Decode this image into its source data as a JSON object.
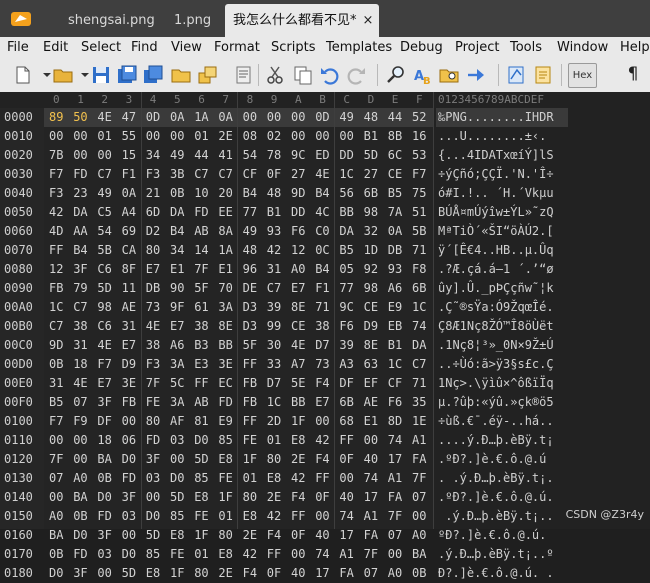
{
  "tabs": [
    {
      "label": "shengsai.png",
      "active": false
    },
    {
      "label": "1.png",
      "active": false
    },
    {
      "label": "我怎么什么都看不见*",
      "active": true
    }
  ],
  "tab_close_glyph": "×",
  "menu": [
    "File",
    "Edit",
    "Select",
    "Find",
    "View",
    "Format",
    "Scripts",
    "Templates",
    "Debug",
    "Project",
    "Tools",
    "Window",
    "Help"
  ],
  "toolbar": {
    "hex_label": "Hex",
    "pilcrow": "¶"
  },
  "ruler": {
    "hex": [
      "0",
      "1",
      "2",
      "3",
      "4",
      "5",
      "6",
      "7",
      "8",
      "9",
      "A",
      "B",
      "C",
      "D",
      "E",
      "F"
    ],
    "ascii": "0123456789ABCDEF"
  },
  "rows": [
    {
      "addr": "0000",
      "bytes": [
        "89",
        "50",
        "4E",
        "47",
        "0D",
        "0A",
        "1A",
        "0A",
        "00",
        "00",
        "00",
        "0D",
        "49",
        "48",
        "44",
        "52"
      ],
      "ascii": "‰PNG........IHDR"
    },
    {
      "addr": "0010",
      "bytes": [
        "00",
        "00",
        "01",
        "55",
        "00",
        "00",
        "01",
        "2E",
        "08",
        "02",
        "00",
        "00",
        "00",
        "B1",
        "8B",
        "16"
      ],
      "ascii": "...U........±‹."
    },
    {
      "addr": "0020",
      "bytes": [
        "7B",
        "00",
        "00",
        "15",
        "34",
        "49",
        "44",
        "41",
        "54",
        "78",
        "9C",
        "ED",
        "DD",
        "5D",
        "6C",
        "53"
      ],
      "ascii": "{...4IDATxœíÝ]lS"
    },
    {
      "addr": "0030",
      "bytes": [
        "F7",
        "FD",
        "C7",
        "F1",
        "F3",
        "3B",
        "C7",
        "C7",
        "CF",
        "0F",
        "27",
        "4E",
        "1C",
        "27",
        "CE",
        "F7"
      ],
      "ascii": "÷ýÇñó;ÇÇÏ.'N.'Î÷"
    },
    {
      "addr": "0040",
      "bytes": [
        "F3",
        "23",
        "49",
        "0A",
        "21",
        "0B",
        "10",
        "20",
        "B4",
        "48",
        "9D",
        "B4",
        "56",
        "6B",
        "B5",
        "75"
      ],
      "ascii": "ó#I.!.. ´H.´Vkµu"
    },
    {
      "addr": "0050",
      "bytes": [
        "42",
        "DA",
        "C5",
        "A4",
        "6D",
        "DA",
        "FD",
        "EE",
        "77",
        "B1",
        "DD",
        "4C",
        "BB",
        "98",
        "7A",
        "51"
      ],
      "ascii": "BÚÅ¤mÚýîw±ÝL»˜zQ"
    },
    {
      "addr": "0060",
      "bytes": [
        "4D",
        "AA",
        "54",
        "69",
        "D2",
        "B4",
        "AB",
        "8A",
        "49",
        "93",
        "F6",
        "C0",
        "DA",
        "32",
        "0A",
        "5B"
      ],
      "ascii": "MªTiÒ´«ŠI“öÀÚ2.["
    },
    {
      "addr": "0070",
      "bytes": [
        "FF",
        "B4",
        "5B",
        "CA",
        "80",
        "34",
        "14",
        "1A",
        "48",
        "42",
        "12",
        "0C",
        "B5",
        "1D",
        "DB",
        "71"
      ],
      "ascii": "ÿ´[Ê€4..HB..µ.Ûq"
    },
    {
      "addr": "0080",
      "bytes": [
        "12",
        "3F",
        "C6",
        "8F",
        "E7",
        "E1",
        "7F",
        "E1",
        "96",
        "31",
        "A0",
        "B4",
        "05",
        "92",
        "93",
        "F8"
      ],
      "ascii": ".?Æ.çá.á–1 ´.’“ø"
    },
    {
      "addr": "0090",
      "bytes": [
        "FB",
        "79",
        "5D",
        "11",
        "DB",
        "90",
        "5F",
        "70",
        "DE",
        "C7",
        "E7",
        "F1",
        "77",
        "98",
        "A6",
        "6B"
      ],
      "ascii": "ûy].Û._pÞÇçñw˜¦k"
    },
    {
      "addr": "00A0",
      "bytes": [
        "1C",
        "C7",
        "98",
        "AE",
        "73",
        "9F",
        "61",
        "3A",
        "D3",
        "39",
        "8E",
        "71",
        "9C",
        "CE",
        "E9",
        "1C"
      ],
      "ascii": ".Ç˜®sŸa:Ó9ŽqœÎé."
    },
    {
      "addr": "00B0",
      "bytes": [
        "C7",
        "38",
        "C6",
        "31",
        "4E",
        "E7",
        "38",
        "8E",
        "D3",
        "99",
        "CE",
        "38",
        "F6",
        "D9",
        "EB",
        "74"
      ],
      "ascii": "Ç8Æ1Nç8ŽÓ™Î8öÙët"
    },
    {
      "addr": "00C0",
      "bytes": [
        "9D",
        "31",
        "4E",
        "E7",
        "38",
        "A6",
        "B3",
        "BB",
        "5F",
        "30",
        "4E",
        "D7",
        "39",
        "8E",
        "B1",
        "DA"
      ],
      "ascii": ".1Nç8¦³»_0N×9Ž±Ú"
    },
    {
      "addr": "00D0",
      "bytes": [
        "0B",
        "18",
        "F7",
        "D9",
        "F3",
        "3A",
        "E3",
        "3E",
        "FF",
        "33",
        "A7",
        "73",
        "A3",
        "63",
        "1C",
        "C7"
      ],
      "ascii": "..÷Ùó:ã>ÿ3§s£c.Ç"
    },
    {
      "addr": "00E0",
      "bytes": [
        "31",
        "4E",
        "E7",
        "3E",
        "7F",
        "5C",
        "FF",
        "EC",
        "FB",
        "D7",
        "5E",
        "F4",
        "DF",
        "EF",
        "CF",
        "71"
      ],
      "ascii": "1Nç>.\\ÿìû×^ôßïÏq"
    },
    {
      "addr": "00F0",
      "bytes": [
        "B5",
        "07",
        "3F",
        "FB",
        "FE",
        "3A",
        "AB",
        "FD",
        "FB",
        "1C",
        "BB",
        "E7",
        "6B",
        "AE",
        "F6",
        "35"
      ],
      "ascii": "µ.?ûþ:«ýû.»çk®ö5"
    },
    {
      "addr": "0100",
      "bytes": [
        "F7",
        "F9",
        "DF",
        "00",
        "80",
        "AF",
        "81",
        "E9",
        "FF",
        "2D",
        "1F",
        "00",
        "68",
        "E1",
        "8D",
        "1E"
      ],
      "ascii": "÷ùß.€¯.éÿ-..há.."
    },
    {
      "addr": "0110",
      "bytes": [
        "00",
        "00",
        "18",
        "06",
        "FD",
        "03",
        "D0",
        "85",
        "FE",
        "01",
        "E8",
        "42",
        "FF",
        "00",
        "74",
        "A1"
      ],
      "ascii": "....ý.Ð…þ.èBÿ.t¡"
    },
    {
      "addr": "0120",
      "bytes": [
        "7F",
        "00",
        "BA",
        "D0",
        "3F",
        "00",
        "5D",
        "E8",
        "1F",
        "80",
        "2E",
        "F4",
        "0F",
        "40",
        "17",
        "FA"
      ],
      "ascii": ".ºÐ?.]è.€.ô.@.ú"
    },
    {
      "addr": "0130",
      "bytes": [
        "07",
        "A0",
        "0B",
        "FD",
        "03",
        "D0",
        "85",
        "FE",
        "01",
        "E8",
        "42",
        "FF",
        "00",
        "74",
        "A1",
        "7F"
      ],
      "ascii": ". .ý.Ð…þ.èBÿ.t¡."
    },
    {
      "addr": "0140",
      "bytes": [
        "00",
        "BA",
        "D0",
        "3F",
        "00",
        "5D",
        "E8",
        "1F",
        "80",
        "2E",
        "F4",
        "0F",
        "40",
        "17",
        "FA",
        "07"
      ],
      "ascii": ".ºÐ?.]è.€.ô.@.ú."
    },
    {
      "addr": "0150",
      "bytes": [
        "A0",
        "0B",
        "FD",
        "03",
        "D0",
        "85",
        "FE",
        "01",
        "E8",
        "42",
        "FF",
        "00",
        "74",
        "A1",
        "7F",
        "00"
      ],
      "ascii": " .ý.Ð…þ.èBÿ.t¡.."
    },
    {
      "addr": "0160",
      "bytes": [
        "BA",
        "D0",
        "3F",
        "00",
        "5D",
        "E8",
        "1F",
        "80",
        "2E",
        "F4",
        "0F",
        "40",
        "17",
        "FA",
        "07",
        "A0"
      ],
      "ascii": "ºÐ?.]è.€.ô.@.ú. "
    },
    {
      "addr": "0170",
      "bytes": [
        "0B",
        "FD",
        "03",
        "D0",
        "85",
        "FE",
        "01",
        "E8",
        "42",
        "FF",
        "00",
        "74",
        "A1",
        "7F",
        "00",
        "BA"
      ],
      "ascii": ".ý.Ð…þ.èBÿ.t¡..º"
    },
    {
      "addr": "0180",
      "bytes": [
        "D0",
        "3F",
        "00",
        "5D",
        "E8",
        "1F",
        "80",
        "2E",
        "F4",
        "0F",
        "40",
        "17",
        "FA",
        "07",
        "A0",
        "0B"
      ],
      "ascii": "Ð?.]è.€.ô.@.ú. ."
    }
  ],
  "watermark": "CSDN @Z3r4y"
}
